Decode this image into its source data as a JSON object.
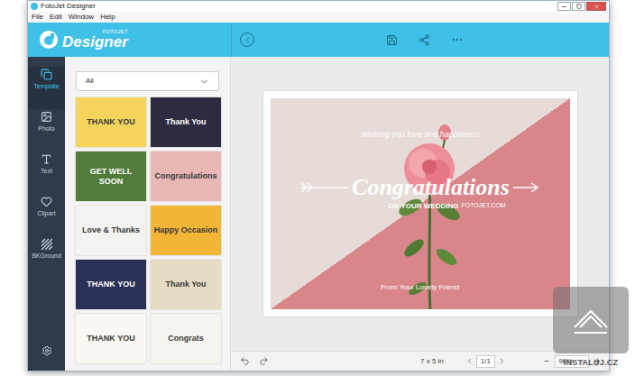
{
  "window": {
    "title": "FotoJet Designer"
  },
  "menu": [
    "File",
    "Edit",
    "Window",
    "Help"
  ],
  "logo": {
    "brand": "FOTOJET",
    "name": "Designer"
  },
  "sidebar": {
    "items": [
      {
        "label": "Template",
        "selected": true
      },
      {
        "label": "Photo",
        "selected": false
      },
      {
        "label": "Text",
        "selected": false
      },
      {
        "label": "Clipart",
        "selected": false
      },
      {
        "label": "BKGround",
        "selected": false
      }
    ]
  },
  "template_panel": {
    "filter": "All",
    "templates": [
      {
        "title": "THANK YOU",
        "color": "#f4d45c"
      },
      {
        "title": "Thank You",
        "color": "#2e2b40"
      },
      {
        "title": "GET WELL SOON",
        "color": "#527c3c"
      },
      {
        "title": "Congratulations",
        "color": "#e9b7b6"
      },
      {
        "title": "Love & Thanks",
        "color": "#f3f4f2"
      },
      {
        "title": "Happy Occasion",
        "color": "#f3b536"
      },
      {
        "title": "THANK YOU",
        "color": "#2b3056"
      },
      {
        "title": "Thank You",
        "color": "#e6dcc4"
      },
      {
        "title": "THANK YOU",
        "color": "#fbf7f2"
      },
      {
        "title": "Congrats",
        "color": "#f6f4ee"
      }
    ]
  },
  "card": {
    "greeting": "Wishing you love and happiness!",
    "title": "Congratulations",
    "subtitle": "ON YOUR WEDDING",
    "site": "FOTOJET.COM",
    "signature": "From Your Lovely Friend"
  },
  "status_bar": {
    "size": "7 x 5 in",
    "page": "1/1",
    "zoom": "96%",
    "zoom_out": "−",
    "zoom_in": "+"
  },
  "watermark": {
    "text": "INSTALUJ.CZ"
  }
}
